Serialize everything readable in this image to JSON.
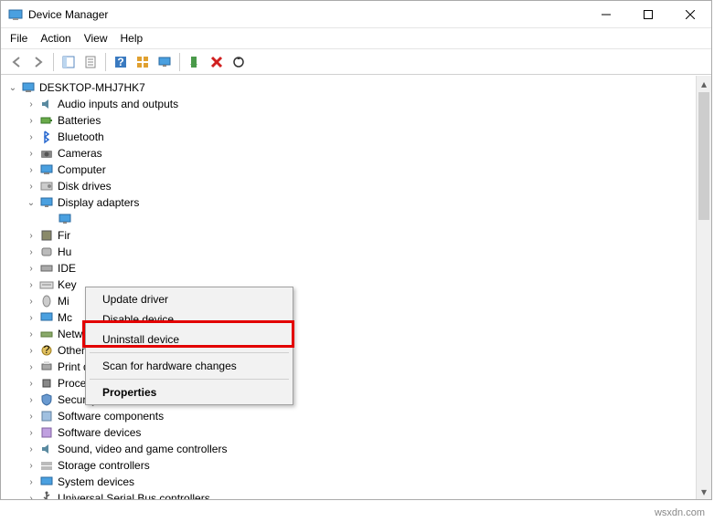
{
  "window": {
    "title": "Device Manager"
  },
  "menubar": [
    "File",
    "Action",
    "View",
    "Help"
  ],
  "toolbar": [
    {
      "name": "back-icon"
    },
    {
      "name": "forward-icon"
    },
    "div",
    {
      "name": "show-hidden-icon"
    },
    {
      "name": "properties-icon"
    },
    "div",
    {
      "name": "help-icon"
    },
    {
      "name": "grid-icon"
    },
    {
      "name": "monitor-icon"
    },
    "div",
    {
      "name": "enable-icon"
    },
    {
      "name": "disable-x-icon"
    },
    {
      "name": "update-driver-icon"
    }
  ],
  "tree": {
    "root": {
      "label": "DESKTOP-MHJ7HK7",
      "expanded": true
    },
    "categories": [
      {
        "label": "Audio inputs and outputs",
        "icon": "audio"
      },
      {
        "label": "Batteries",
        "icon": "battery"
      },
      {
        "label": "Bluetooth",
        "icon": "bluetooth"
      },
      {
        "label": "Cameras",
        "icon": "camera"
      },
      {
        "label": "Computer",
        "icon": "computer"
      },
      {
        "label": "Disk drives",
        "icon": "disk"
      },
      {
        "label": "Display adapters",
        "icon": "display",
        "expanded": true,
        "children": [
          {
            "label": "",
            "icon": "display"
          }
        ]
      },
      {
        "label": "Fir",
        "icon": "firmware",
        "cut": true
      },
      {
        "label": "Hu",
        "icon": "hid",
        "cut": true
      },
      {
        "label": "IDE",
        "icon": "ide",
        "cut": true
      },
      {
        "label": "Key",
        "icon": "keyboard",
        "cut": true
      },
      {
        "label": "Mi",
        "icon": "mouse",
        "cut": true
      },
      {
        "label": "Mc",
        "icon": "monitor",
        "cut": true
      },
      {
        "label": "Network adapters",
        "icon": "network"
      },
      {
        "label": "Other devices",
        "icon": "other"
      },
      {
        "label": "Print queues",
        "icon": "printer"
      },
      {
        "label": "Processors",
        "icon": "cpu"
      },
      {
        "label": "Security devices",
        "icon": "security"
      },
      {
        "label": "Software components",
        "icon": "swcomp"
      },
      {
        "label": "Software devices",
        "icon": "swdev"
      },
      {
        "label": "Sound, video and game controllers",
        "icon": "sound"
      },
      {
        "label": "Storage controllers",
        "icon": "storage"
      },
      {
        "label": "System devices",
        "icon": "system"
      },
      {
        "label": "Universal Serial Bus controllers",
        "icon": "usb"
      }
    ]
  },
  "context_menu": {
    "items": [
      {
        "label": "Update driver"
      },
      {
        "label": "Disable device"
      },
      {
        "label": "Uninstall device",
        "highlight": true
      },
      "sep",
      {
        "label": "Scan for hardware changes"
      },
      "sep",
      {
        "label": "Properties",
        "bold": true
      }
    ]
  },
  "colors": {
    "highlight_red": "#e30000"
  },
  "watermark": "wsxdn.com"
}
